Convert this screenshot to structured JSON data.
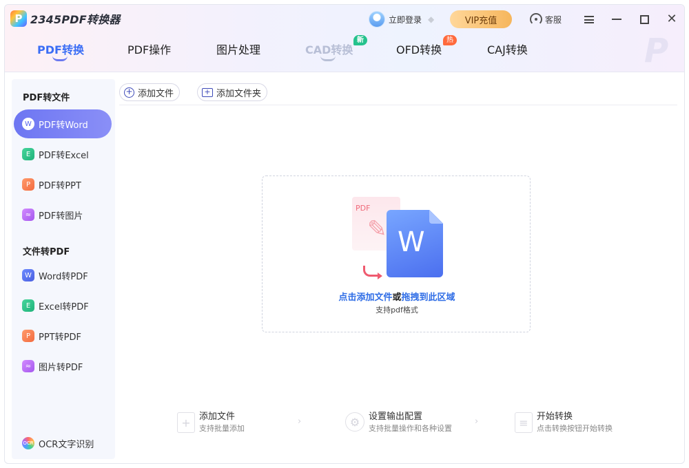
{
  "app": {
    "logo_letter": "P",
    "title": "2345PDF转换器",
    "login_label": "立即登录",
    "vip_label": "VIP充值",
    "service_label": "客服",
    "watermark_letter": "P"
  },
  "tabs": [
    {
      "label": "PDF转换"
    },
    {
      "label": "PDF操作"
    },
    {
      "label": "图片处理"
    },
    {
      "label": "CAD转换",
      "badge": "新"
    },
    {
      "label": "OFD转换",
      "badge": "热"
    },
    {
      "label": "CAJ转换"
    }
  ],
  "sidebar": {
    "section1": "PDF转文件",
    "section2": "文件转PDF",
    "items": [
      {
        "label": "PDF转Word",
        "icon": "word-icon",
        "glyph": "W"
      },
      {
        "label": "PDF转Excel",
        "icon": "excel-icon",
        "glyph": "E"
      },
      {
        "label": "PDF转PPT",
        "icon": "ppt-icon",
        "glyph": "P"
      },
      {
        "label": "PDF转图片",
        "icon": "image-icon",
        "glyph": "≈"
      },
      {
        "label": "Word转PDF",
        "icon": "word-icon",
        "glyph": "W"
      },
      {
        "label": "Excel转PDF",
        "icon": "excel-icon",
        "glyph": "E"
      },
      {
        "label": "PPT转PDF",
        "icon": "ppt-icon",
        "glyph": "P"
      },
      {
        "label": "图片转PDF",
        "icon": "image-icon",
        "glyph": "≈"
      },
      {
        "label": "OCR文字识别",
        "icon": "ocr-icon",
        "glyph": "OCR"
      }
    ]
  },
  "toolbar": {
    "add_file": "添加文件",
    "add_folder": "添加文件夹"
  },
  "dropzone": {
    "pdf_label": "PDF",
    "word_letter": "W",
    "text_click": "点击添加文件",
    "text_or": "或",
    "text_drag": "拖拽到此区域",
    "subtext": "支持pdf格式"
  },
  "steps": [
    {
      "title": "添加文件",
      "desc": "支持批量添加",
      "icon": "add-file-icon"
    },
    {
      "title": "设置输出配置",
      "desc": "支持批量操作和各种设置",
      "icon": "settings-gear-icon"
    },
    {
      "title": "开始转换",
      "desc": "点击转换按钮开始转换",
      "icon": "convert-doc-icon"
    }
  ],
  "colors": {
    "accent": "#3b6ef5",
    "active_item": "#6d76f2",
    "link": "#2f6de6",
    "vip": "#f6b65c",
    "badge_new": "#25c28d",
    "badge_hot": "#ff6a3d"
  }
}
